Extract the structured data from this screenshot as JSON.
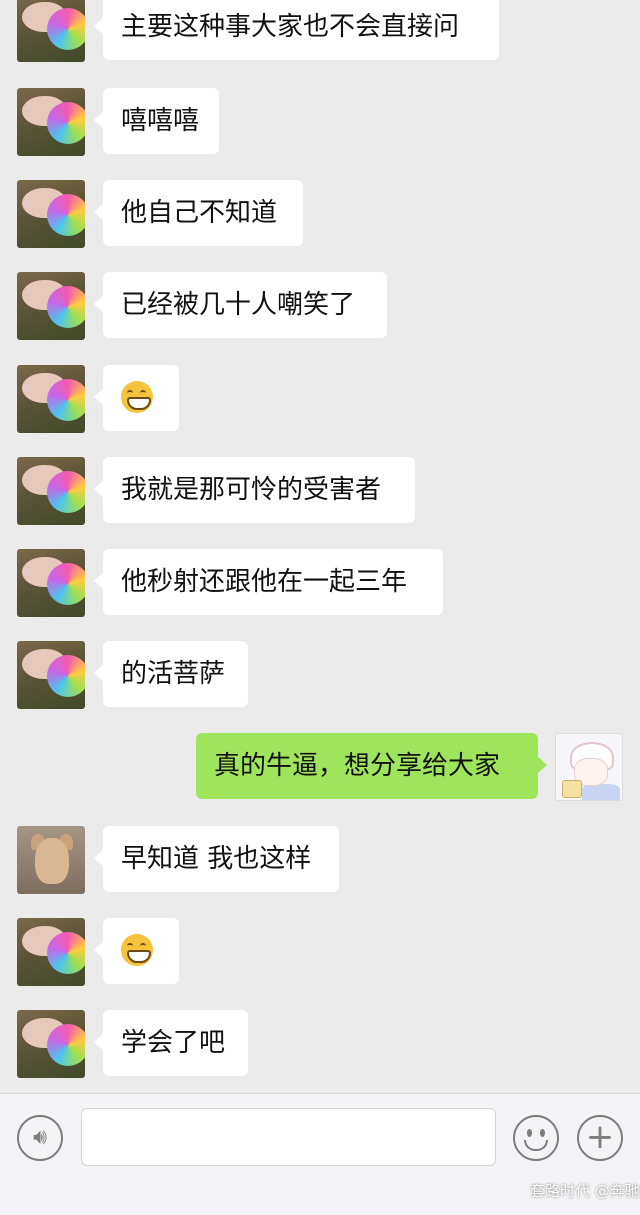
{
  "messages": [
    {
      "side": "left",
      "avatar": "pig",
      "text": "主要这种事大家也不会直接问"
    },
    {
      "side": "left",
      "avatar": "pig",
      "text": "嘻嘻嘻"
    },
    {
      "side": "left",
      "avatar": "pig",
      "text": "他自己不知道"
    },
    {
      "side": "left",
      "avatar": "pig",
      "text": "已经被几十人嘲笑了"
    },
    {
      "side": "left",
      "avatar": "pig",
      "emoji": "grin-icon"
    },
    {
      "side": "left",
      "avatar": "pig",
      "text": "我就是那可怜的受害者"
    },
    {
      "side": "left",
      "avatar": "pig",
      "text": "他秒射还跟他在一起三年"
    },
    {
      "side": "left",
      "avatar": "pig",
      "text": "的活菩萨"
    },
    {
      "side": "right",
      "avatar": "anime",
      "text": "真的牛逼，想分享给大家"
    },
    {
      "side": "left",
      "avatar": "dog",
      "text": "早知道 我也这样"
    },
    {
      "side": "left",
      "avatar": "pig",
      "emoji": "grin-icon"
    },
    {
      "side": "left",
      "avatar": "pig",
      "text": "学会了吧"
    }
  ],
  "input_bar": {
    "voice_icon": "voice-icon",
    "emoji_icon": "emoji-icon",
    "plus_icon": "plus-icon",
    "plus_glyph": "+",
    "voice_glyph": "🔊︎"
  },
  "watermark": {
    "text": "套路时代",
    "sub": "@奔驰"
  },
  "colors": {
    "background": "#ebebeb",
    "bubble_left": "#ffffff",
    "bubble_right": "#9fe55c"
  }
}
